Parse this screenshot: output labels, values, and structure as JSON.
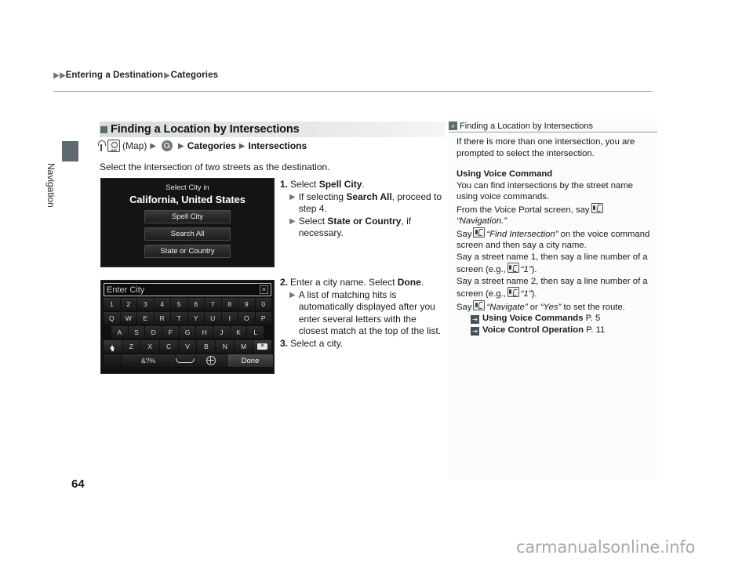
{
  "breadcrumb": {
    "item1": "Entering a Destination",
    "item2": "Categories"
  },
  "sidebar_tab": {
    "label": "Navigation"
  },
  "section": {
    "heading": "Finding a Location by Intersections",
    "path": {
      "map_label": "(Map)",
      "categories": "Categories",
      "intersections": "Intersections"
    },
    "intro": "Select the intersection of two streets as the destination."
  },
  "device_screen_1": {
    "title_small": "Select City in",
    "title_large": "California, United States",
    "buttons": [
      "Spell City",
      "Search All",
      "State or Country"
    ]
  },
  "device_screen_2": {
    "input_placeholder": "Enter City",
    "rows": [
      [
        "1",
        "2",
        "3",
        "4",
        "5",
        "6",
        "7",
        "8",
        "9",
        "0"
      ],
      [
        "Q",
        "W",
        "E",
        "R",
        "T",
        "Y",
        "U",
        "I",
        "O",
        "P"
      ],
      [
        "A",
        "S",
        "D",
        "F",
        "G",
        "H",
        "J",
        "K",
        "L"
      ],
      [
        "Z",
        "X",
        "C",
        "V",
        "B",
        "N",
        "M"
      ]
    ],
    "symbol_key": "&?%",
    "done_key": "Done"
  },
  "steps_group_1": [
    {
      "num": "1.",
      "text_pre": "Select ",
      "bold": "Spell City",
      "text_post": ".",
      "subs": [
        {
          "pre": "If selecting ",
          "bold": "Search All",
          "post": ", proceed to step 4."
        },
        {
          "pre": "Select ",
          "bold": "State or Country",
          "post": ", if necessary."
        }
      ]
    }
  ],
  "steps_group_2": [
    {
      "num": "2.",
      "text_pre": "Enter a city name. Select ",
      "bold": "Done",
      "text_post": ".",
      "subs": [
        {
          "pre": "",
          "bold": "",
          "post": "A list of matching hits is automatically displayed after you enter several letters with the closest match at the top of the list."
        }
      ]
    },
    {
      "num": "3.",
      "text_pre": "Select a city.",
      "bold": "",
      "text_post": "",
      "subs": []
    }
  ],
  "right_panel": {
    "heading": "Finding a Location by Intersections",
    "para1": "If there is more than one intersection, you are prompted to select the intersection.",
    "subhead": "Using Voice Command",
    "para2": "You can find intersections by the street name using voice commands.",
    "line_portal_pre": "From the Voice Portal screen, say",
    "line_portal_quote": "“Navigation.”",
    "line_find_pre": "Say",
    "line_find_quote": "“Find Intersection”",
    "line_find_post": "on the voice command screen and then say a city name.",
    "line_street1": "Say a street name 1, then say a line number of a screen (e.g.,",
    "line_street1_quote": "“1”",
    "line_street1_post": ").",
    "line_street2": "Say a street name 2, then say a line number of a screen (e.g.,",
    "line_street2_quote": "“1”",
    "line_street2_post": ").",
    "line_nav_pre": "Say",
    "line_nav_quote": "“Navigate”",
    "line_nav_mid": "or",
    "line_nav_quote2": "“Yes”",
    "line_nav_post": "to set the route.",
    "refs": [
      {
        "title": "Using Voice Commands",
        "page": "P. 5"
      },
      {
        "title": "Voice Control Operation",
        "page": "P. 11"
      }
    ]
  },
  "page_number": "64",
  "watermark": "carmanualsonline.info"
}
